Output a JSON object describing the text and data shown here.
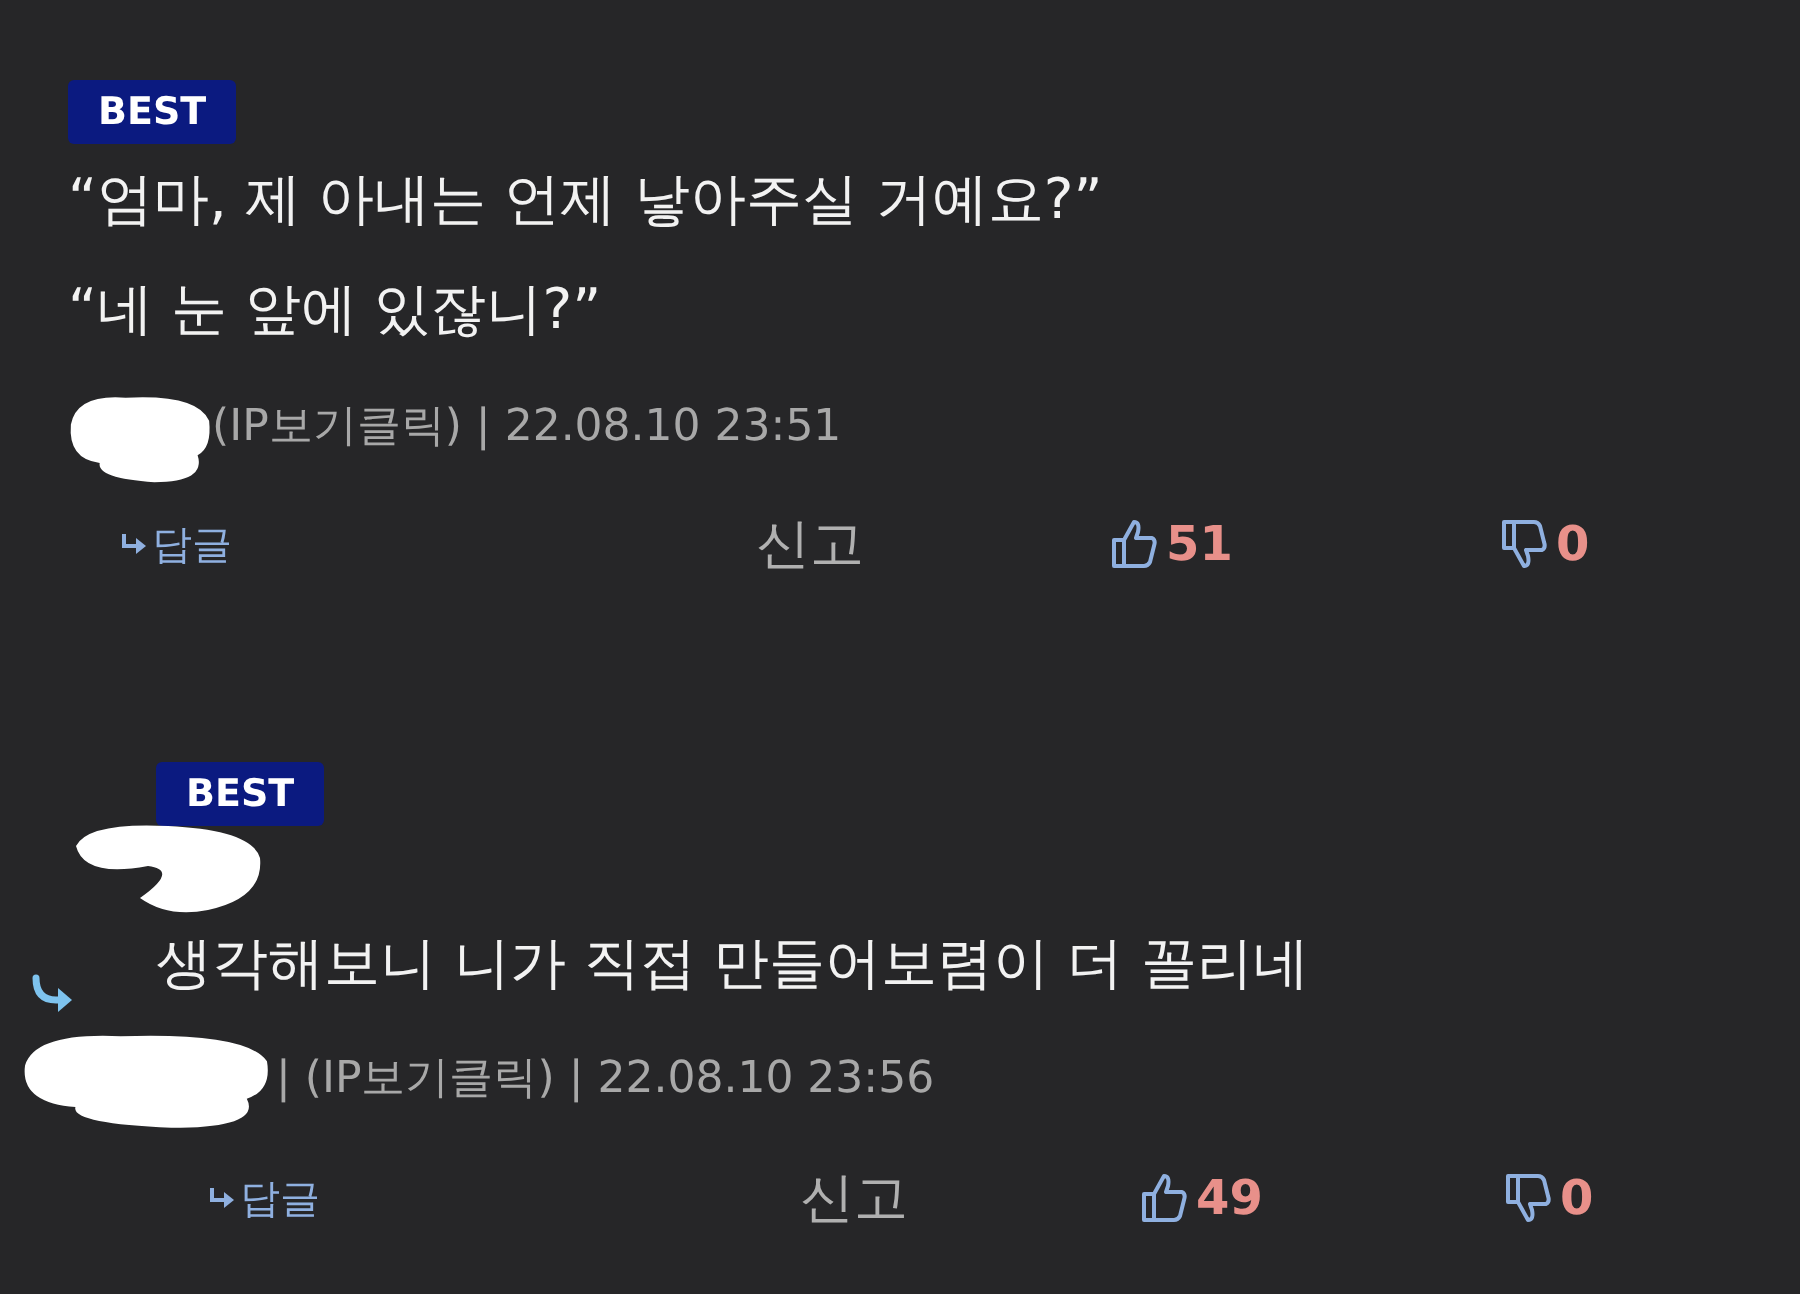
{
  "comments": [
    {
      "kind": "comment",
      "badge": "BEST",
      "lines": [
        "“엄마, 제 아내는 언제 낳아주실 거예요?”",
        "“네 눈 앞에 있잖니?”"
      ],
      "meta": "(IP보기클릭) | 22.08.10 23:51",
      "reply": "답글",
      "report": "신고",
      "likes": "51",
      "dislikes": "0"
    },
    {
      "kind": "reply",
      "badge": "BEST",
      "lines": [
        "생각해보니 니가 직접 만들어보렴이 더 꼴리네"
      ],
      "meta": "| (IP보기클릭) | 22.08.10 23:56",
      "reply": "답글",
      "report": "신고",
      "likes": "49",
      "dislikes": "0"
    }
  ]
}
